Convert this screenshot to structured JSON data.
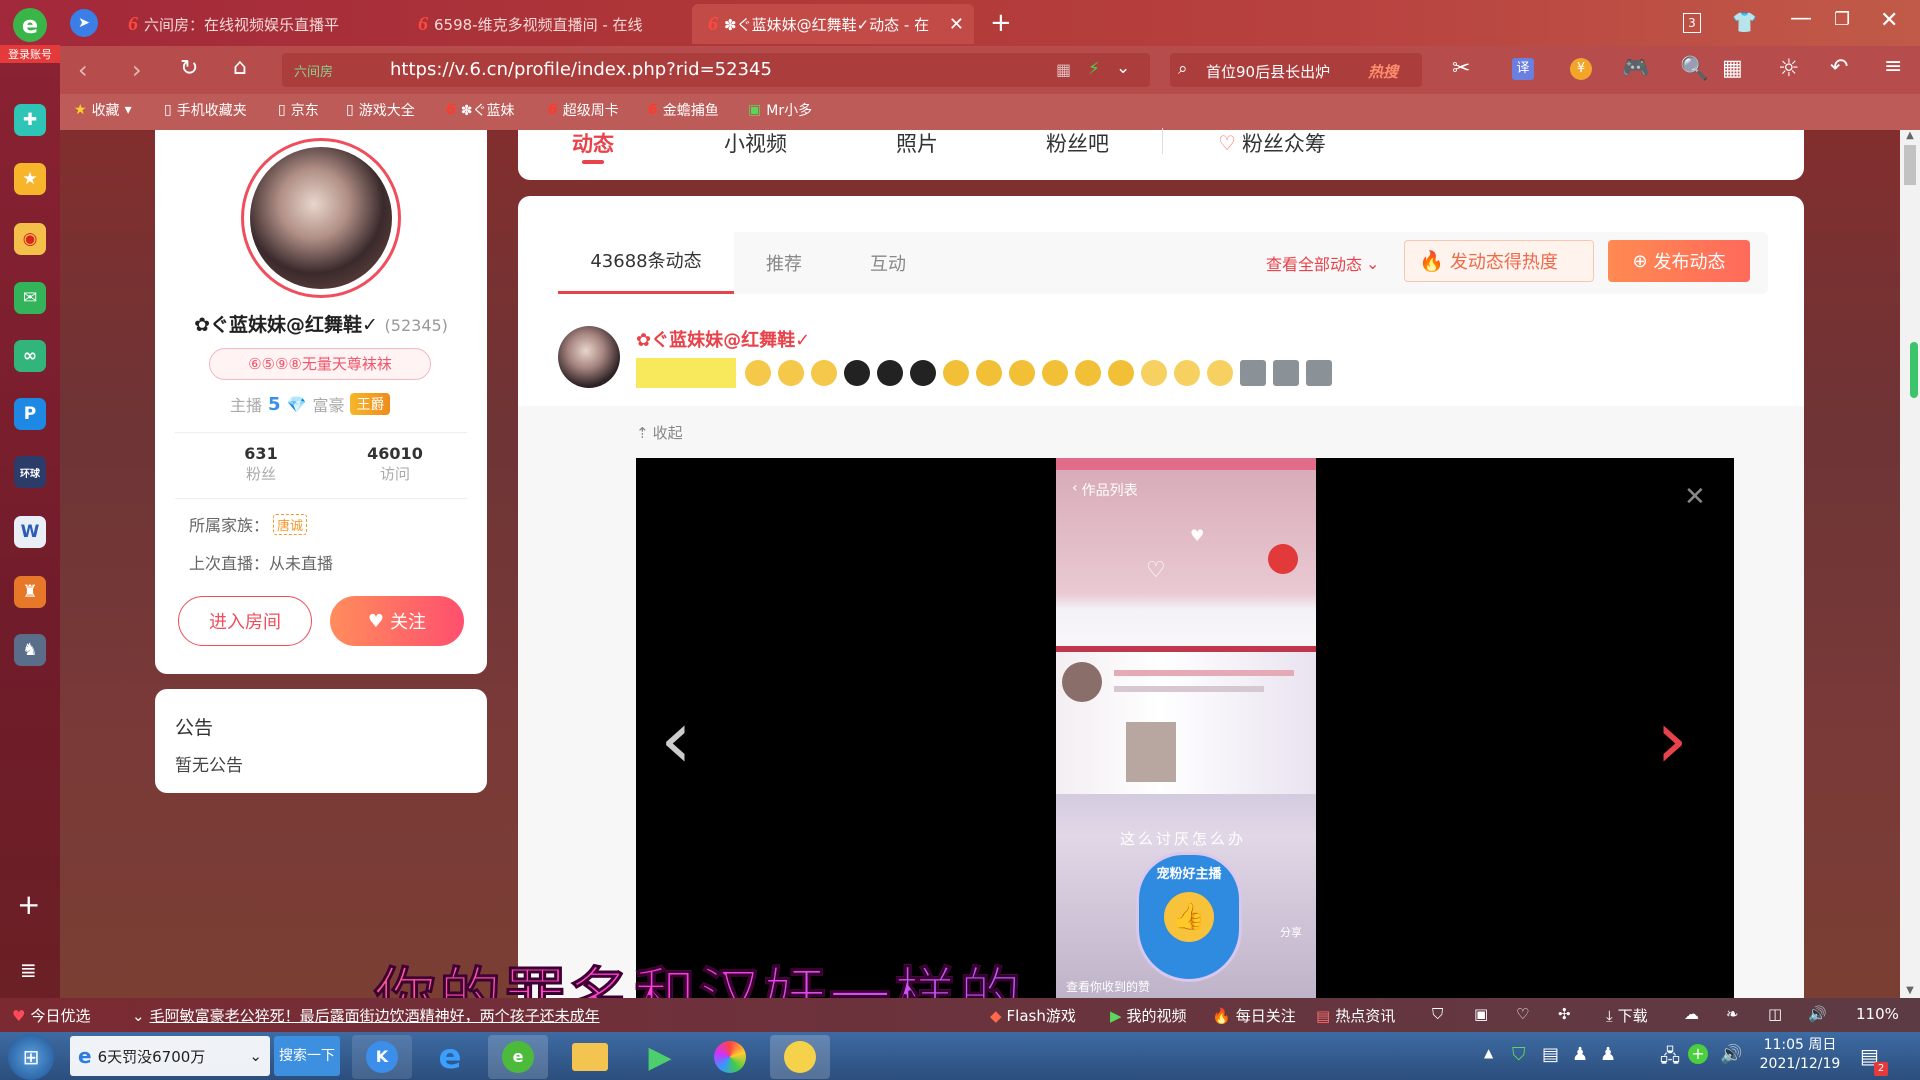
{
  "browser": {
    "tabs": [
      {
        "label": "六间房：在线视频娱乐直播平"
      },
      {
        "label": "6598-维克多视频直播间 - 在线"
      },
      {
        "label": "✽ぐ蓝妹妹@红舞鞋✓动态 - 在"
      }
    ],
    "tab_count": "3",
    "url": "https://v.6.cn/profile/index.php?rid=52345",
    "url_site_label": "六间房",
    "search_text": "首位90后县长出炉",
    "search_hot": "热搜",
    "translate": "译",
    "login_label": "登录账号"
  },
  "bookmarks": [
    {
      "label": "收藏"
    },
    {
      "label": "手机收藏夹"
    },
    {
      "label": "京东"
    },
    {
      "label": "游戏大全"
    },
    {
      "label": "✽ぐ蓝妹"
    },
    {
      "label": "超级周卡"
    },
    {
      "label": "金蟾捕鱼"
    },
    {
      "label": "Mr小多"
    }
  ],
  "profile": {
    "name": "✿ぐ蓝妹妹@红舞鞋✓",
    "rid": "(52345)",
    "medal": "⑥⑤⑨⑧无量天尊袜袜",
    "host_label": "主播",
    "host_level": "5",
    "rich_label": "富豪",
    "rich_badge": "王爵",
    "fans_count": "631",
    "fans_label": "粉丝",
    "visits_count": "46010",
    "visits_label": "访问",
    "family_label": "所属家族：",
    "family_badge": "唐诚",
    "last_live": "上次直播：从未直播",
    "enter_room": "进入房间",
    "follow": "关注"
  },
  "notice": {
    "title": "公告",
    "body": "暂无公告"
  },
  "nav": {
    "tabs": [
      "动态",
      "小视频",
      "照片",
      "粉丝吧",
      "粉丝众筹"
    ]
  },
  "feed": {
    "tabs": [
      "43688条动态",
      "推荐",
      "互动"
    ],
    "view_all": "查看全部动态",
    "hot_button": "发动态得热度",
    "publish_button": "发布动态",
    "post_author": "✿ぐ蓝妹妹@红舞鞋✓",
    "collapse": "收起"
  },
  "phone_screen": {
    "title": "作品列表",
    "caption1": "这么讨厌怎么办",
    "caption2": "宠粉好主播",
    "footer": "查看你收到的赞",
    "share": "分享"
  },
  "subtitle": "你的罪名和汉奸一样的",
  "news_bar": {
    "items": [
      {
        "label": "今日优选"
      },
      {
        "label": "毛阿敏富豪老公猝死！最后露面街边饮酒精神好，两个孩子还未成年"
      },
      {
        "label": "Flash游戏"
      },
      {
        "label": "我的视频"
      },
      {
        "label": "每日关注"
      },
      {
        "label": "热点资讯"
      },
      {
        "label": "下载"
      }
    ],
    "zoom": "110%"
  },
  "taskbar": {
    "ie_item": "6天罚没6700万",
    "search_btn": "搜索一下",
    "time": "11:05 周日",
    "date": "2021/12/19",
    "badge": "2"
  },
  "colors": {
    "accent": "#e8434a",
    "follow_gradient_start": "#ff8d5c",
    "follow_gradient_end": "#ff4f6e",
    "publish_bg": "#ff7a52"
  }
}
